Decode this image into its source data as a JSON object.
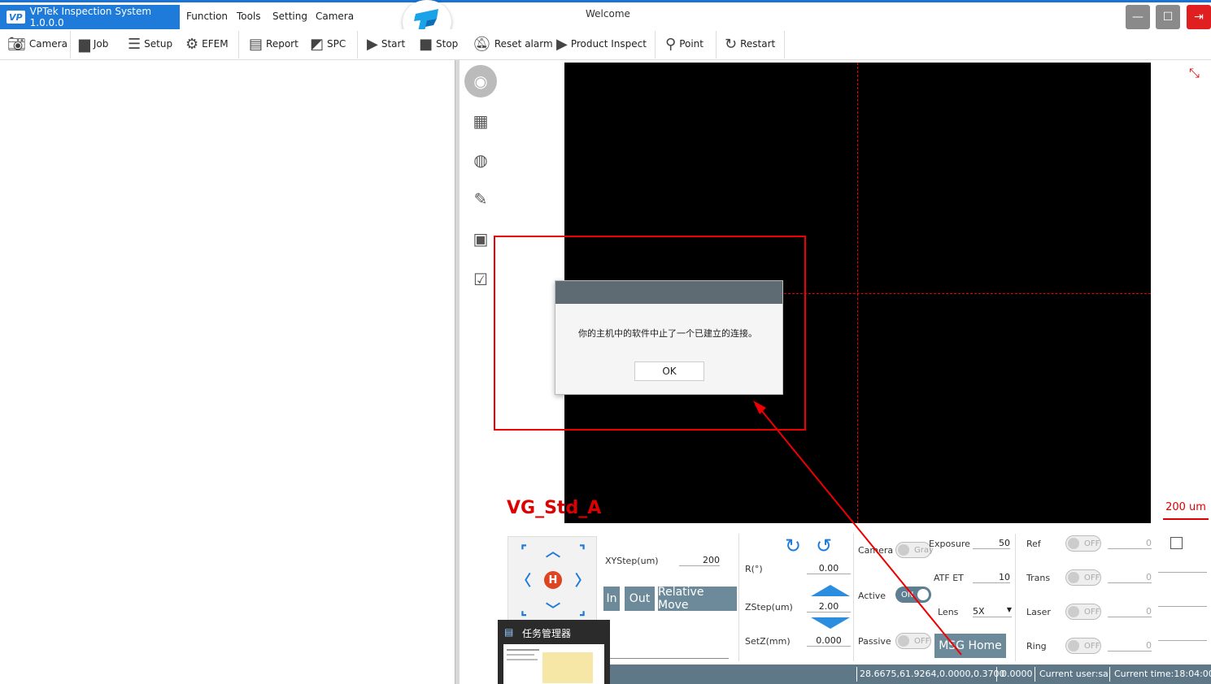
{
  "title_bar": {
    "app_title": "VPTek Inspection System 1.0.0.0",
    "menus": [
      "Function",
      "Tools",
      "Setting",
      "Camera"
    ],
    "welcome": "Welcome",
    "minimize": "—",
    "maximize": "☐",
    "exit": "⇥"
  },
  "toolbar": {
    "camera": "Camera",
    "job": "Job",
    "setup": "Setup",
    "efem": "EFEM",
    "report": "Report",
    "spc": "SPC",
    "start": "Start",
    "stop": "Stop",
    "reset_alarm": "Reset alarm",
    "product_inspect": "Product Inspect",
    "point": "Point",
    "restart": "Restart"
  },
  "viewer": {
    "recipe_label": "VG_Std_A",
    "scale_label": "200 um"
  },
  "dialog": {
    "message": "你的主机中的软件中止了一个已建立的连接。",
    "ok_label": "OK"
  },
  "motion": {
    "xystep_label": "XYStep(um)",
    "xystep_value": "200",
    "in_label": "In",
    "out_label": "Out",
    "relative_move_label": "Relative Move",
    "r_label": "R(°)",
    "r_value": "0.00",
    "zstep_label": "ZStep(um)",
    "zstep_value": "2.00",
    "setz_label": "SetZ(mm)",
    "setz_value": "0.000",
    "home_glyph": "H"
  },
  "camera_ctrl": {
    "camera_label": "Camera",
    "camera_toggle": "Gray",
    "active_label": "Active",
    "active_toggle": "ON",
    "passive_label": "Passive",
    "passive_toggle": "OFF",
    "exposure_label": "Exposure",
    "exposure_value": "50",
    "atf_label": "ATF ET",
    "atf_value": "10",
    "lens_label": "Lens",
    "lens_value": "5X",
    "msg_home_label": "MSG Home"
  },
  "light_ctrl": {
    "ref_label": "Ref",
    "trans_label": "Trans",
    "laser_label": "Laser",
    "ring_label": "Ring",
    "off": "OFF",
    "zero": "0"
  },
  "taskbar_preview": {
    "title": "任务管理器"
  },
  "status": {
    "position": "28.6675,61.9264,0.0000,0.3700",
    "value": "0.0000",
    "user": "Current user:sa",
    "time": "Current time:18:04:00"
  }
}
